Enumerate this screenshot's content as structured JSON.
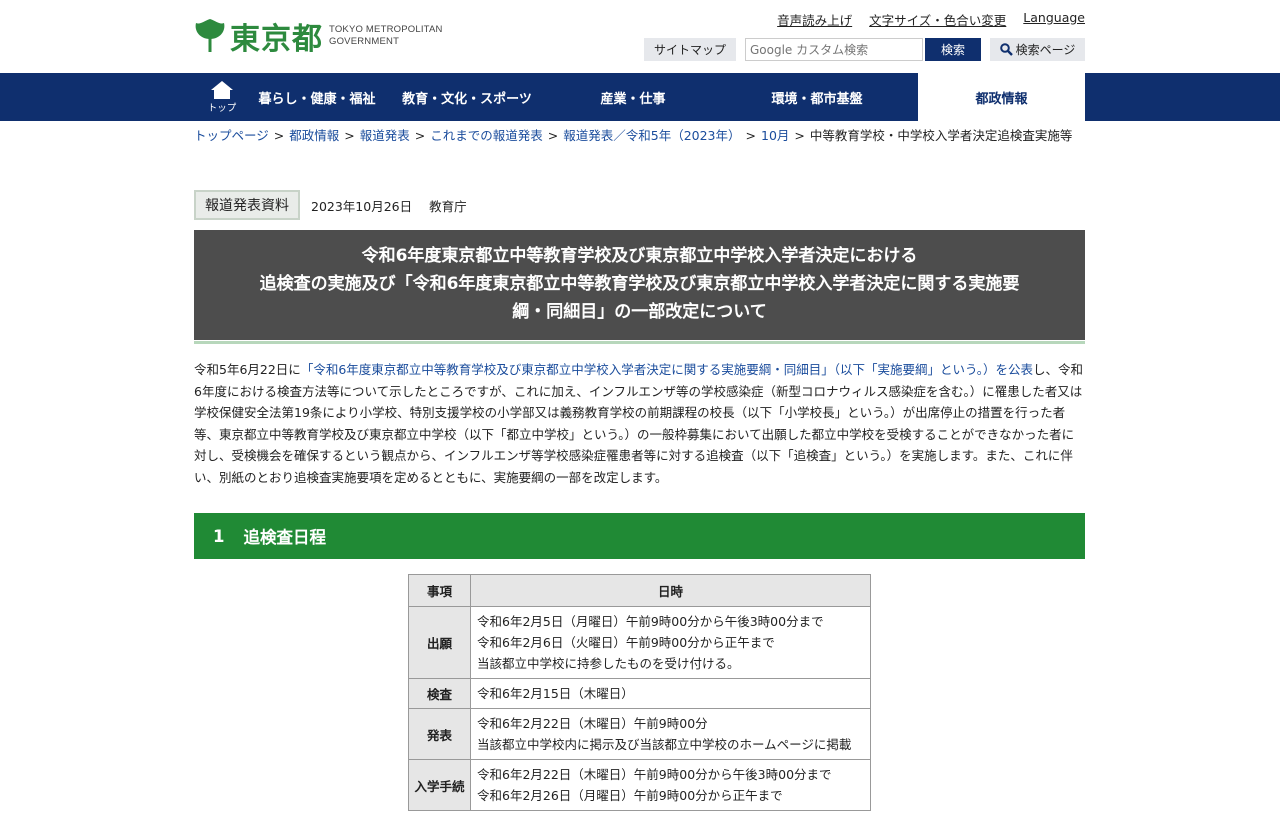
{
  "header": {
    "logo_text": "東京都",
    "logo_en_line1": "TOKYO METROPOLITAN",
    "logo_en_line2": "GOVERNMENT",
    "util_links": [
      "音声読み上げ",
      "文字サイズ・色合い変更",
      "Language"
    ],
    "sitemap_label": "サイトマップ",
    "search_placeholder": "Google カスタム検索",
    "search_label": "検索",
    "search_page_label": "検索ページ"
  },
  "nav": {
    "home_label": "トップ",
    "items": [
      "暮らし・健康・福祉",
      "教育・文化・スポーツ",
      "産業・仕事",
      "環境・都市基盤",
      "都政情報"
    ],
    "active_index": 4
  },
  "breadcrumb": {
    "links": [
      "トップページ",
      "都政情報",
      "報道発表",
      "これまでの報道発表",
      "報道発表／令和5年（2023年）",
      "10月"
    ],
    "current": "中等教育学校・中学校入学者決定追検査実施等"
  },
  "press": {
    "badge": "報道発表資料",
    "date": "2023年10月26日",
    "org": "教育庁"
  },
  "title": {
    "line1": "令和6年度東京都立中等教育学校及び東京都立中学校入学者決定における",
    "line2": "追検査の実施及び「令和6年度東京都立中等教育学校及び東京都立中学校入学者決定に関する実施要",
    "line3": "綱・同細目」の一部改定について"
  },
  "body": {
    "prefix": "令和5年6月22日に",
    "link": "「令和6年度東京都立中等教育学校及び東京都立中学校入学者決定に関する実施要綱・同細目」（以下「実施要綱」という。）を公表",
    "rest": "し、令和6年度における検査方法等について示したところですが、これに加え、インフルエンザ等の学校感染症（新型コロナウィルス感染症を含む。）に罹患した者又は学校保健安全法第19条により小学校、特別支援学校の小学部又は義務教育学校の前期課程の校長（以下「小学校長」という。）が出席停止の措置を行った者等、東京都立中等教育学校及び東京都立中学校（以下「都立中学校」という。）の一般枠募集において出願した都立中学校を受検することができなかった者に対し、受検機会を確保するという観点から、インフルエンザ等学校感染症罹患者等に対する追検査（以下「追検査」という。）を実施します。また、これに伴い、別紙のとおり追検査実施要項を定めるとともに、実施要綱の一部を改定します。"
  },
  "section1": {
    "number": "1",
    "title": "追検査日程"
  },
  "schedule": {
    "header_item": "事項",
    "header_date": "日時",
    "rows": [
      {
        "label": "出願",
        "lines": [
          "令和6年2月5日（月曜日）午前9時00分から午後3時00分まで",
          "令和6年2月6日（火曜日）午前9時00分から正午まで",
          "当該都立中学校に持参したものを受け付ける。"
        ]
      },
      {
        "label": "検査",
        "lines": [
          "令和6年2月15日（木曜日）"
        ]
      },
      {
        "label": "発表",
        "lines": [
          "令和6年2月22日（木曜日）午前9時00分",
          "当該都立中学校内に掲示及び当該都立中学校のホームページに掲載"
        ]
      },
      {
        "label": "入学手続",
        "lines": [
          "令和6年2月22日（木曜日）午前9時00分から午後3時00分まで",
          "令和6年2月26日（月曜日）午前9時00分から正午まで"
        ]
      }
    ]
  }
}
